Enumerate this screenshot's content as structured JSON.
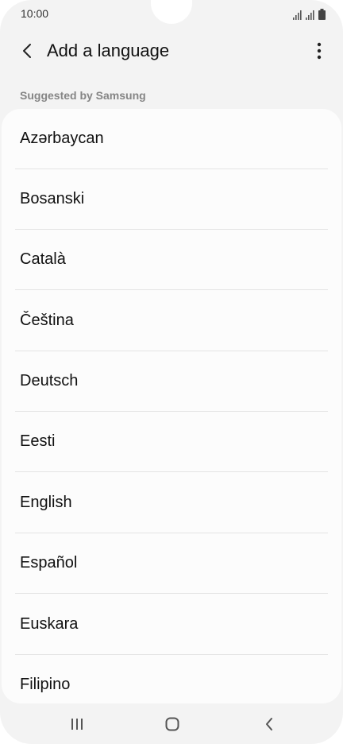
{
  "status_bar": {
    "time": "10:00",
    "icons": [
      "signal-icon",
      "signal-icon",
      "battery-icon"
    ]
  },
  "header": {
    "back_icon": "chevron-left-icon",
    "title": "Add a language",
    "more_icon": "more-vertical-icon"
  },
  "section": {
    "title": "Suggested by Samsung"
  },
  "languages": [
    {
      "label": "Azərbaycan"
    },
    {
      "label": "Bosanski"
    },
    {
      "label": "Català"
    },
    {
      "label": "Čeština"
    },
    {
      "label": "Deutsch"
    },
    {
      "label": "Eesti"
    },
    {
      "label": "English"
    },
    {
      "label": "Español"
    },
    {
      "label": "Euskara"
    },
    {
      "label": "Filipino"
    }
  ],
  "nav_bar": {
    "icons": [
      "recent-apps-icon",
      "home-icon",
      "back-icon"
    ]
  },
  "colors": {
    "background": "#f3f3f3",
    "card": "#fcfcfc",
    "section_title": "#858585",
    "text": "#111111"
  }
}
